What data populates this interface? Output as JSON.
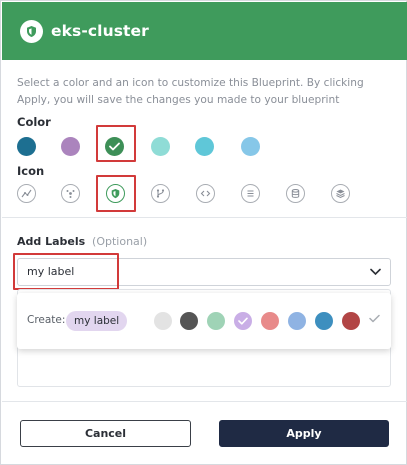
{
  "header": {
    "title": "eks-cluster",
    "background": "#3f9b5c"
  },
  "description": "Select a color and an icon to customize this Blueprint. By clicking Apply, you will save the changes you made to your blueprint",
  "color_section": {
    "label": "Color",
    "options": [
      {
        "color": "#1d6f91",
        "selected": false
      },
      {
        "color": "#ab84bd",
        "selected": false
      },
      {
        "color": "#3d8f57",
        "selected": true
      },
      {
        "color": "#8fdcd6",
        "selected": false
      },
      {
        "color": "#5fc7d8",
        "selected": false
      },
      {
        "color": "#86c7e8",
        "selected": false
      }
    ]
  },
  "icon_section": {
    "label": "Icon",
    "options": [
      {
        "icon": "graph-line-icon",
        "selected": false
      },
      {
        "icon": "cluster-nodes-icon",
        "selected": false
      },
      {
        "icon": "shield-icon",
        "selected": true
      },
      {
        "icon": "git-branch-icon",
        "selected": false
      },
      {
        "icon": "code-icon",
        "selected": false
      },
      {
        "icon": "list-icon",
        "selected": false
      },
      {
        "icon": "database-icon",
        "selected": false
      },
      {
        "icon": "layers-icon",
        "selected": false
      }
    ]
  },
  "labels": {
    "title": "Add Labels",
    "optional": "(Optional)",
    "input_value": "my label",
    "dropdown": {
      "create_prefix": "Create:",
      "chip_text": "my label",
      "chip_color": "#e2d6ef",
      "swatches": [
        {
          "color": "#e3e3e3",
          "selected": false
        },
        {
          "color": "#555555",
          "selected": false
        },
        {
          "color": "#9fd3b6",
          "selected": false
        },
        {
          "color": "#c9aee6",
          "selected": true
        },
        {
          "color": "#e88a8a",
          "selected": false
        },
        {
          "color": "#8fb3e3",
          "selected": false
        },
        {
          "color": "#3d8fbf",
          "selected": false
        },
        {
          "color": "#b24545",
          "selected": false
        }
      ]
    }
  },
  "footer": {
    "cancel_label": "Cancel",
    "apply_label": "Apply"
  }
}
